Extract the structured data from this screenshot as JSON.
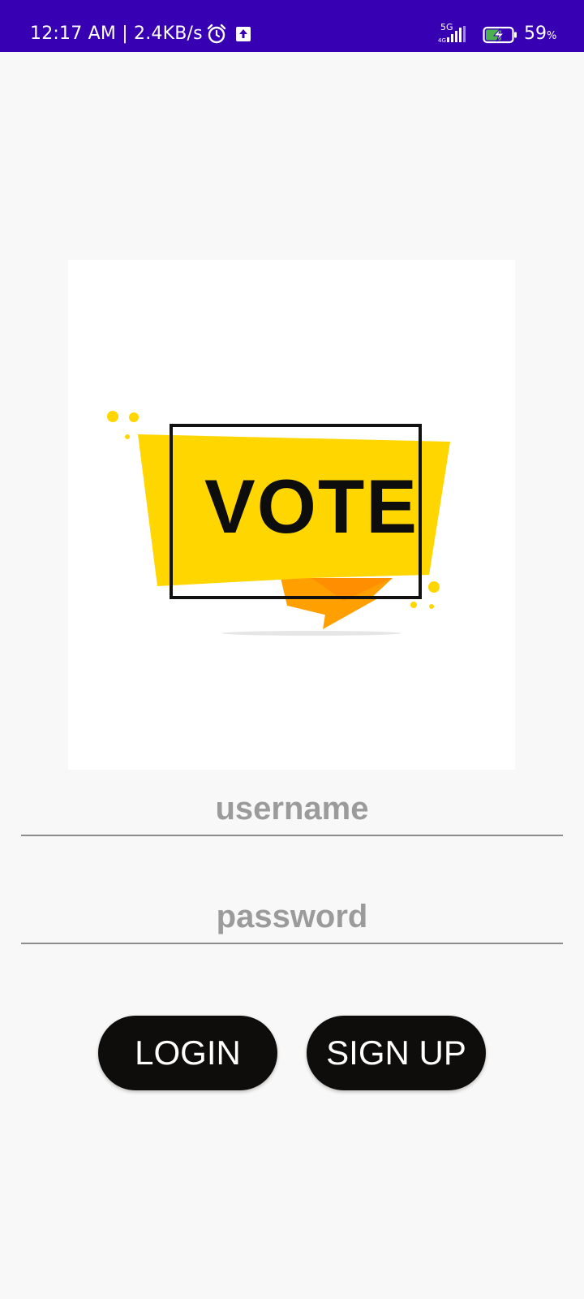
{
  "status_bar": {
    "time_and_speed": "12:17 AM | 2.4KB/s",
    "network_type": "5G",
    "battery_percent": "59",
    "battery_unit": "%",
    "background_color": "#3700b3"
  },
  "logo": {
    "text": "VOTE",
    "banner_color": "#ffd600",
    "ribbon_color": "#ffa000"
  },
  "form": {
    "username_placeholder": "username",
    "password_placeholder": "password",
    "username_value": "",
    "password_value": ""
  },
  "buttons": {
    "login_label": "LOGIN",
    "signup_label": "SIGN UP",
    "background_color": "#0e0d0b"
  }
}
